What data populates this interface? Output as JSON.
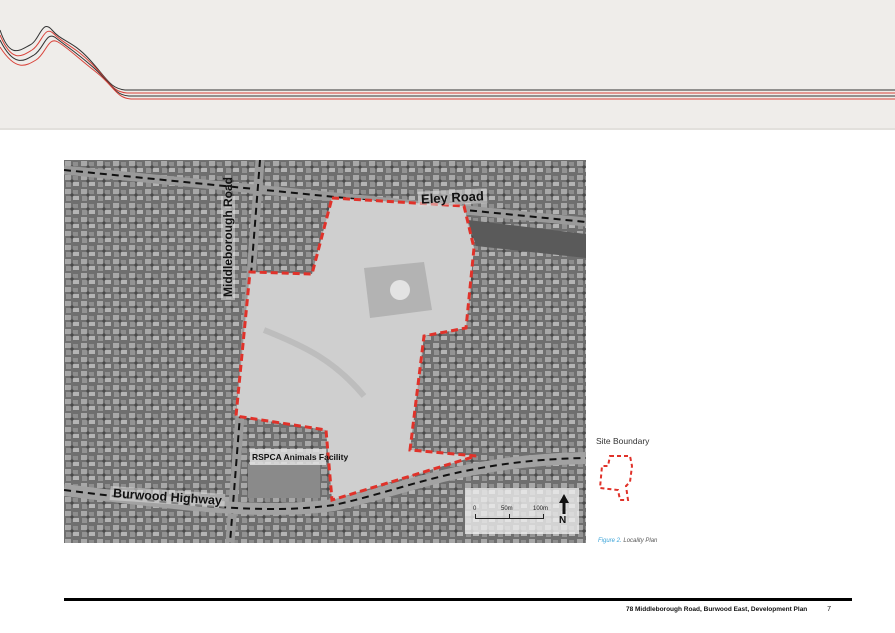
{
  "map": {
    "roads": {
      "eley": "Eley Road",
      "middleborough": "Middleborough Road",
      "burwood": "Burwood Highway"
    },
    "rspca_label": "RSPCA Animals Facility",
    "scale": {
      "zero": "0",
      "fifty": "50m",
      "hundred": "100m"
    },
    "north": "N"
  },
  "legend": {
    "title": "Site Boundary",
    "boundary_color": "#e0322a"
  },
  "caption": {
    "figure": "Figure 2.",
    "title": "Locality Plan"
  },
  "footer": {
    "document": "78 Middleborough Road, Burwood East, Development Plan",
    "page": "7"
  }
}
